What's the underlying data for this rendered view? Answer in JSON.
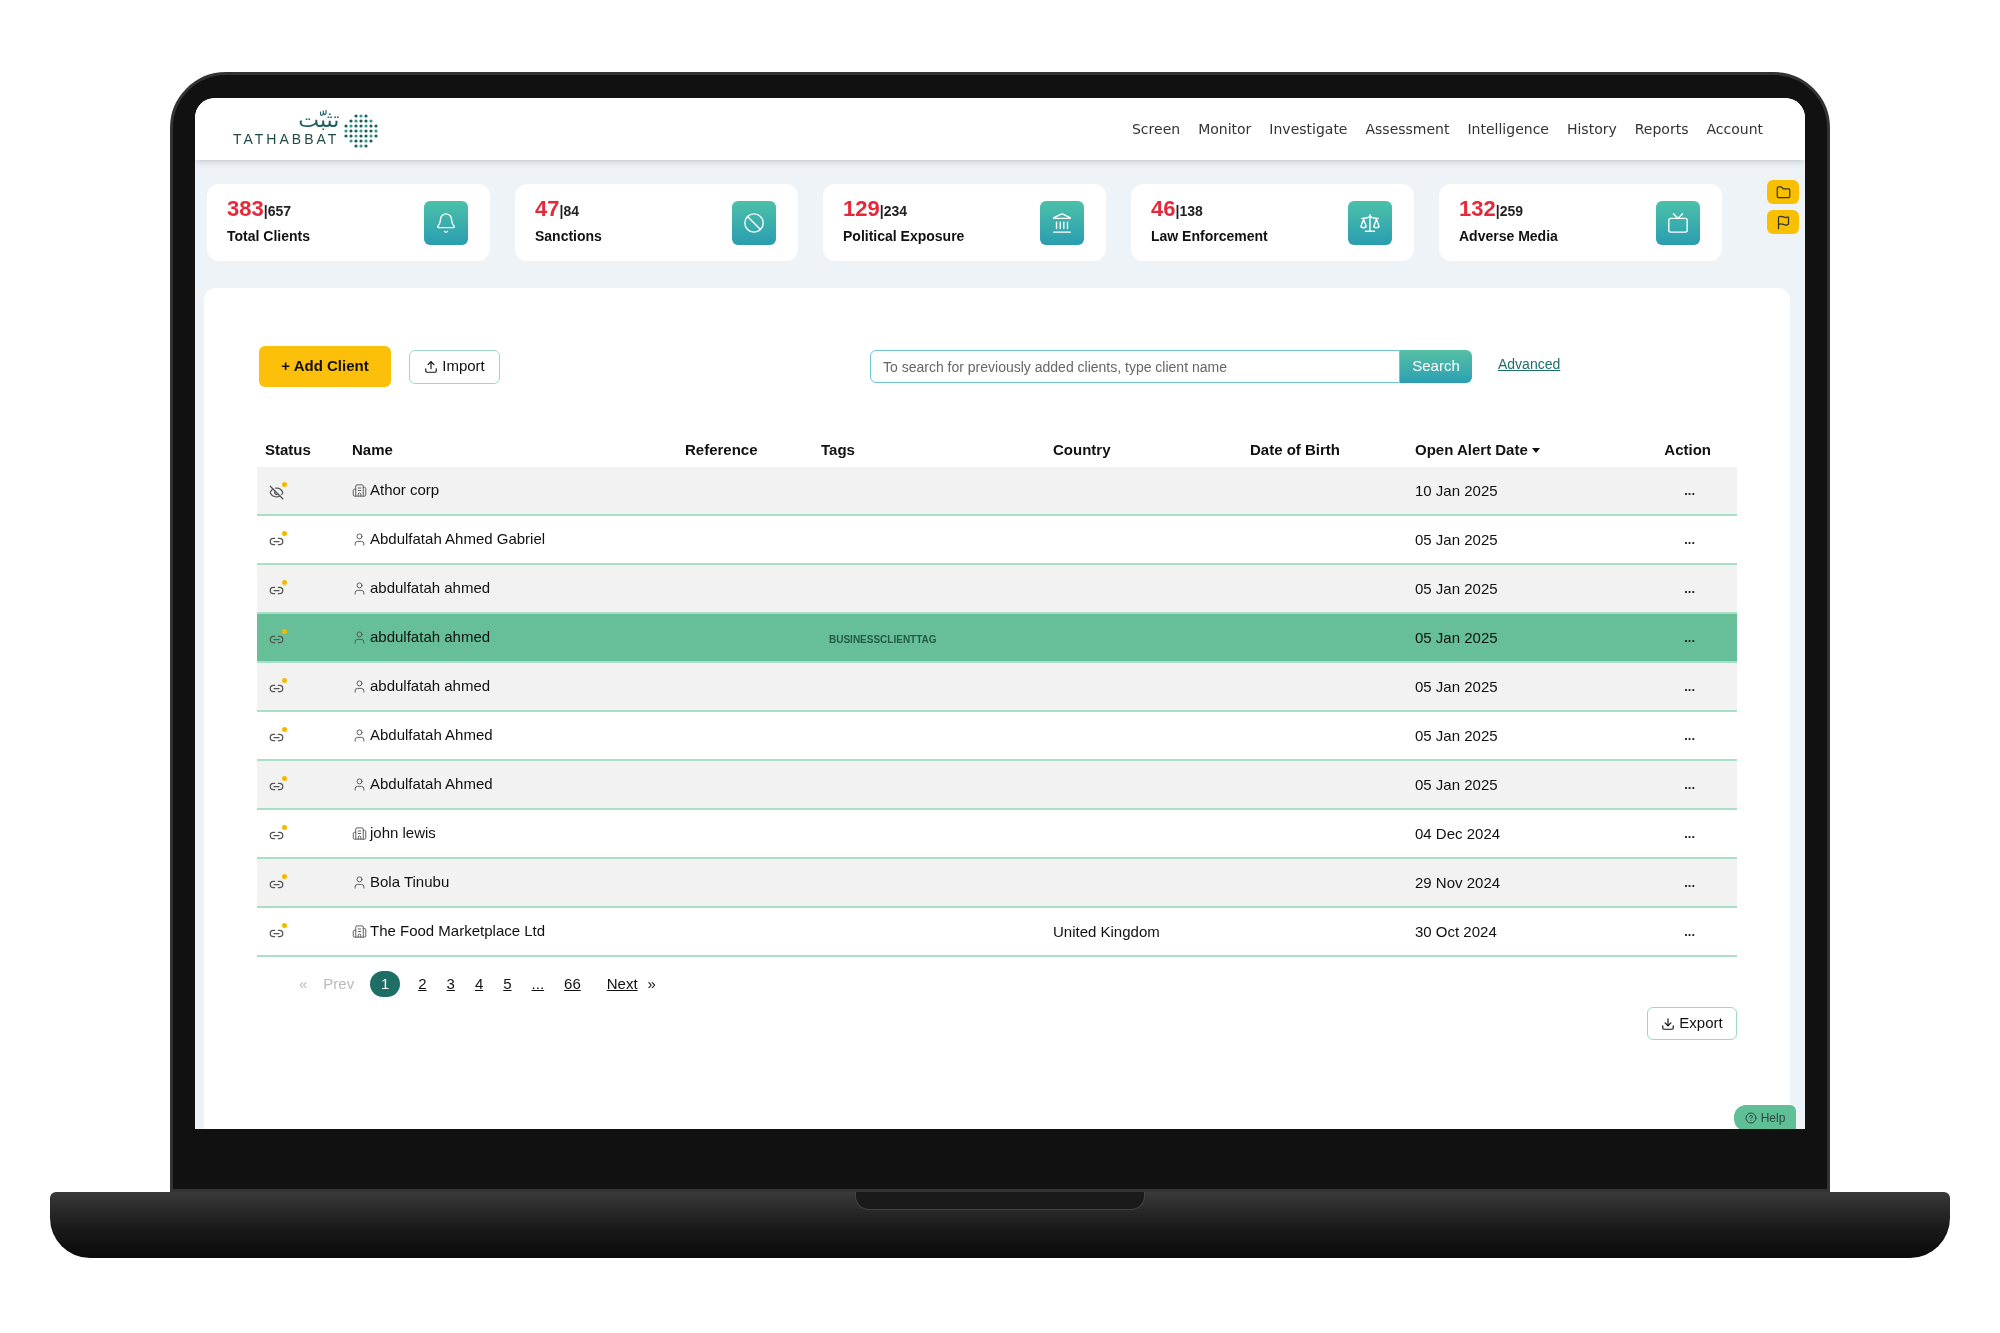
{
  "logo": {
    "arabic": "تثبّت",
    "latin": "TATHABBAT"
  },
  "nav": [
    "Screen",
    "Monitor",
    "Investigate",
    "Assessment",
    "Intelligence",
    "History",
    "Reports",
    "Account"
  ],
  "stats": [
    {
      "value": "383",
      "total": "|657",
      "label": "Total Clients"
    },
    {
      "value": "47",
      "total": "|84",
      "label": "Sanctions"
    },
    {
      "value": "129",
      "total": "|234",
      "label": "Political Exposure"
    },
    {
      "value": "46",
      "total": "|138",
      "label": "Law Enforcement"
    },
    {
      "value": "132",
      "total": "|259",
      "label": "Adverse Media"
    }
  ],
  "toolbar": {
    "add_button": "+ Add Client",
    "import_button": "Import",
    "search": {
      "placeholder": "To search for previously added clients, type client name"
    },
    "search_button": "Search",
    "advanced_link": "Advanced"
  },
  "table": {
    "columns": [
      {
        "label": "Status",
        "sorted": false
      },
      {
        "label": "Name",
        "sorted": false
      },
      {
        "label": "Reference",
        "sorted": false
      },
      {
        "label": "Tags",
        "sorted": false
      },
      {
        "label": "Country",
        "sorted": false
      },
      {
        "label": "Date of Birth",
        "sorted": false
      },
      {
        "label": "Open Alert Date",
        "sorted": true
      },
      {
        "label": "Action",
        "sorted": false
      }
    ],
    "rows": [
      {
        "hidden": true,
        "kind": "company",
        "name": "Athor corp",
        "tag": "",
        "country": "",
        "date": "10 Jan 2025",
        "action": "...",
        "selected": false
      },
      {
        "hidden": false,
        "kind": "person",
        "name": "Abdulfatah Ahmed Gabriel",
        "tag": "",
        "country": "",
        "date": "05 Jan 2025",
        "action": "...",
        "selected": false
      },
      {
        "hidden": false,
        "kind": "person",
        "name": "abdulfatah ahmed",
        "tag": "",
        "country": "",
        "date": "05 Jan 2025",
        "action": "...",
        "selected": false
      },
      {
        "hidden": false,
        "kind": "person",
        "name": "abdulfatah ahmed",
        "tag": "BUSINESSCLIENTTAG",
        "country": "",
        "date": "05 Jan 2025",
        "action": "...",
        "selected": true
      },
      {
        "hidden": false,
        "kind": "person",
        "name": "abdulfatah ahmed",
        "tag": "",
        "country": "",
        "date": "05 Jan 2025",
        "action": "...",
        "selected": false
      },
      {
        "hidden": false,
        "kind": "person",
        "name": "Abdulfatah Ahmed",
        "tag": "",
        "country": "",
        "date": "05 Jan 2025",
        "action": "...",
        "selected": false
      },
      {
        "hidden": false,
        "kind": "person",
        "name": "Abdulfatah Ahmed",
        "tag": "",
        "country": "",
        "date": "05 Jan 2025",
        "action": "...",
        "selected": false
      },
      {
        "hidden": false,
        "kind": "company",
        "name": "john lewis",
        "tag": "",
        "country": "",
        "date": "04 Dec 2024",
        "action": "...",
        "selected": false
      },
      {
        "hidden": false,
        "kind": "person",
        "name": "Bola Tinubu",
        "tag": "",
        "country": "",
        "date": "29 Nov 2024",
        "action": "...",
        "selected": false
      },
      {
        "hidden": false,
        "kind": "company",
        "name": "The Food Marketplace Ltd",
        "tag": "",
        "country": "United Kingdom",
        "date": "30 Oct 2024",
        "action": "...",
        "selected": false
      }
    ]
  },
  "pagination": {
    "first": "«",
    "prev": "Prev",
    "prev_disabled": true,
    "pages": [
      {
        "label": "1",
        "selected": true
      },
      {
        "label": "2",
        "selected": false
      },
      {
        "label": "3",
        "selected": false
      },
      {
        "label": "4",
        "selected": false
      },
      {
        "label": "5",
        "selected": false
      },
      {
        "label": "...",
        "selected": false
      },
      {
        "label": "66",
        "selected": false
      }
    ],
    "next": "Next",
    "last": "»"
  },
  "export_button": "Export",
  "help_button": "Help"
}
